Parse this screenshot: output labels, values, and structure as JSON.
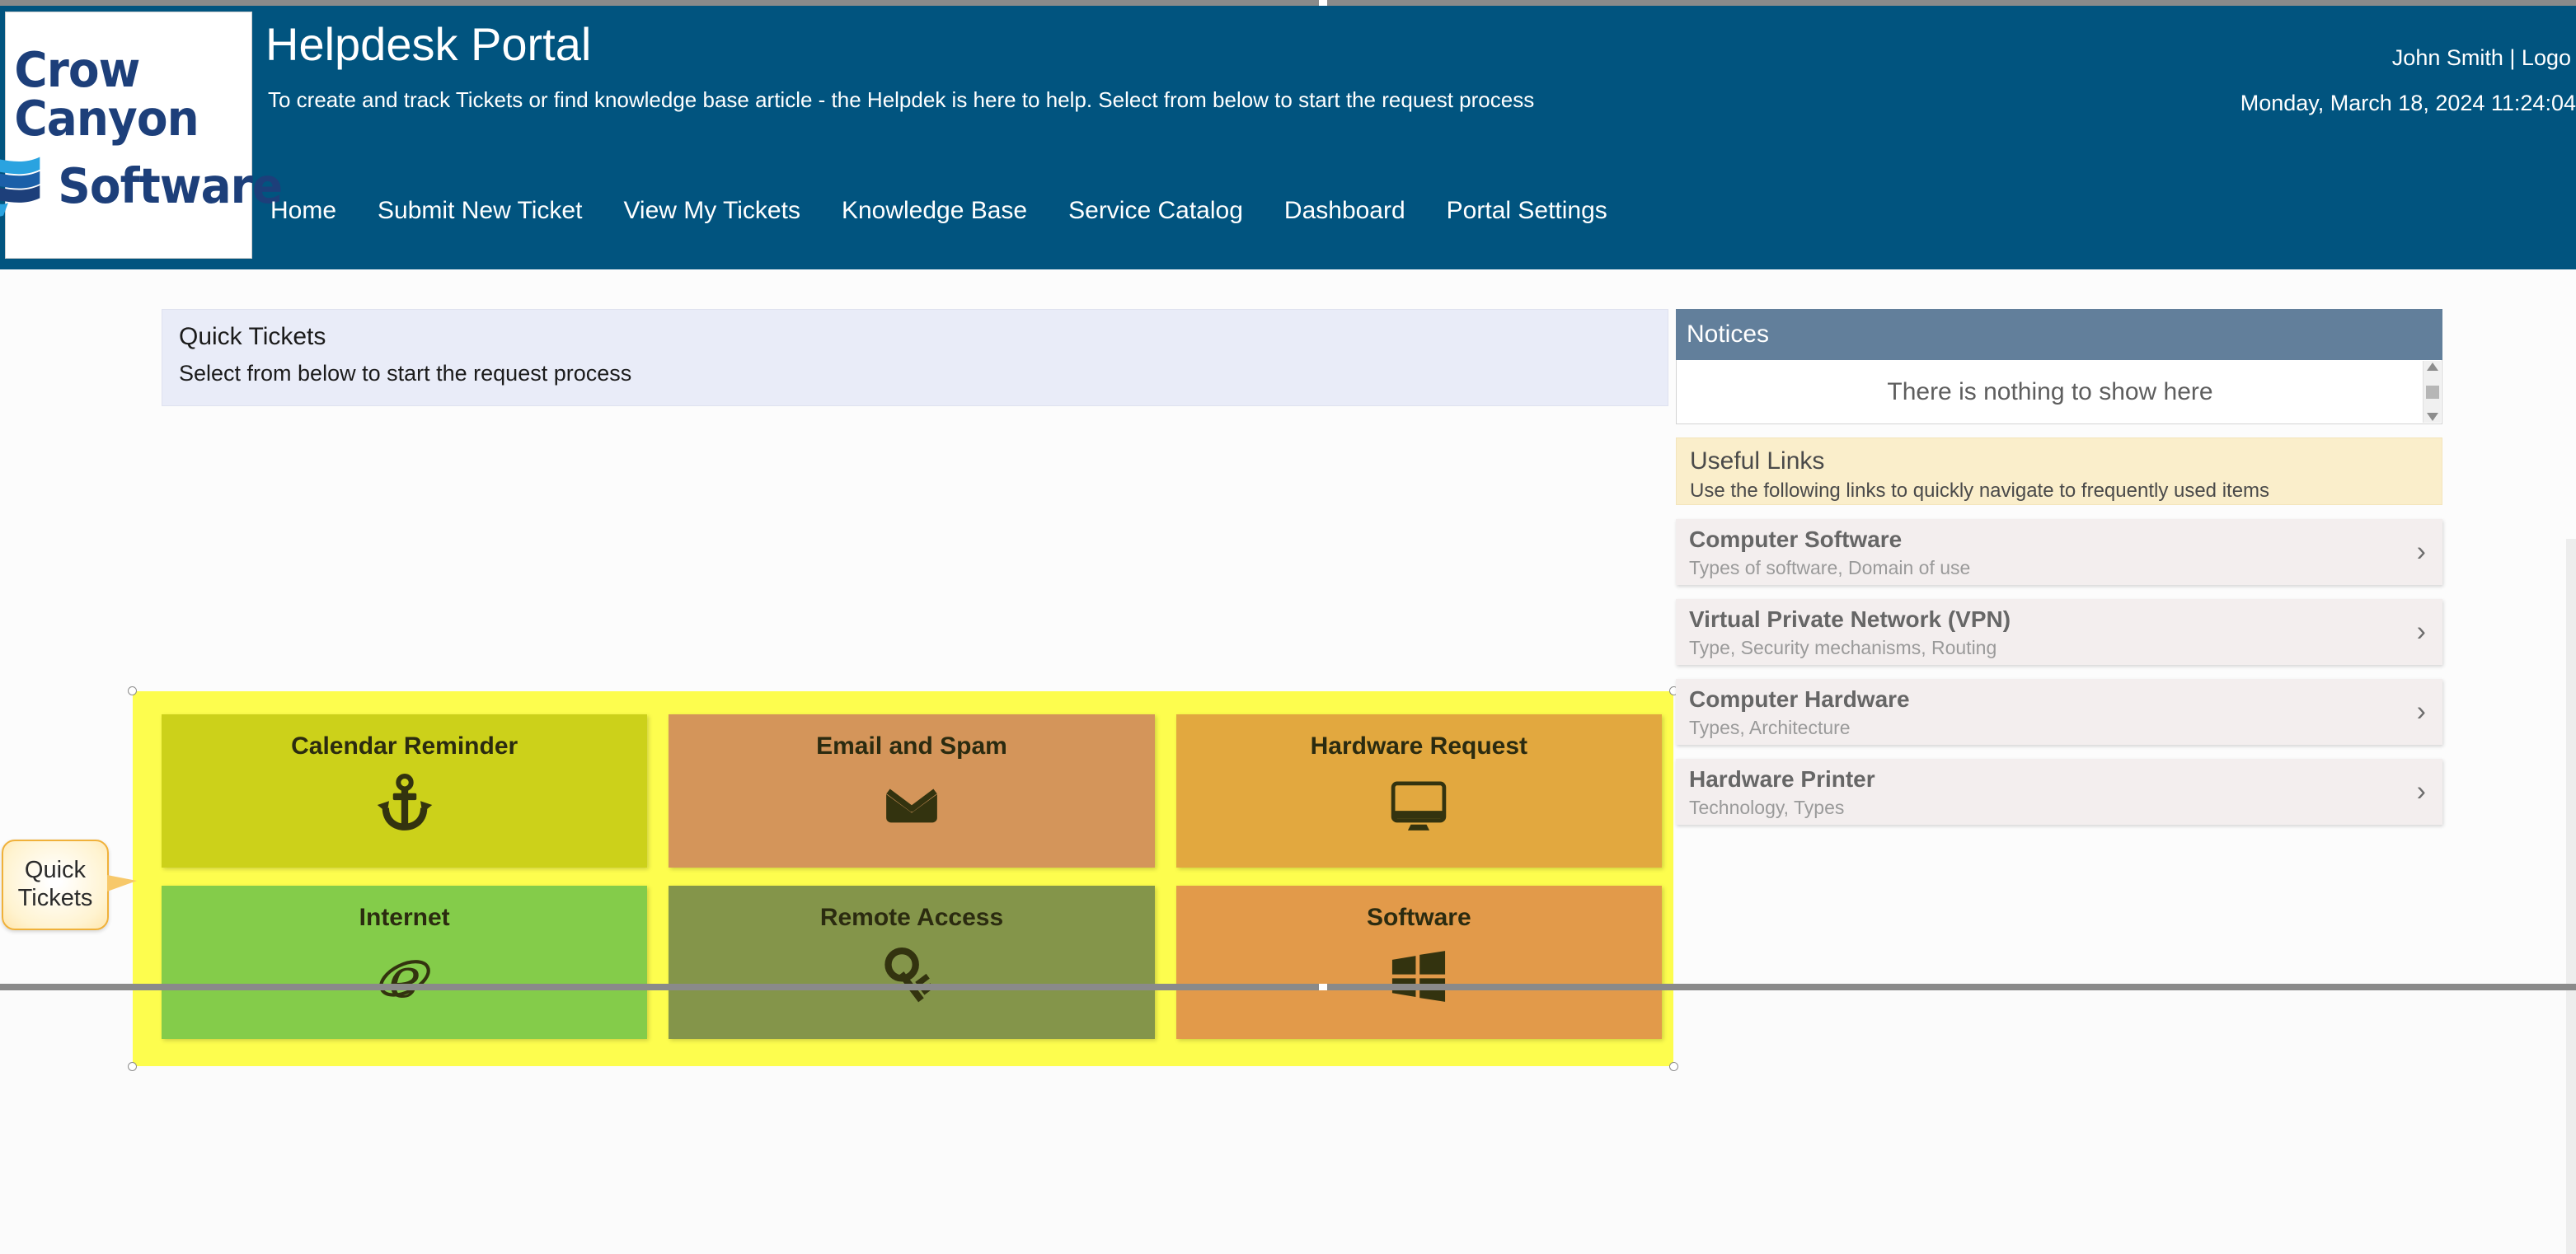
{
  "header": {
    "logo": {
      "line1": "Crow Canyon",
      "line2": "Software",
      "flag_icon": "wave-flag-icon"
    },
    "title": "Helpdesk Portal",
    "subtitle": "To create and track Tickets or find knowledge base article - the Helpdek is here to help. Select from below to start the request process",
    "user_name": "John Smith",
    "separator": "|",
    "logout_label": "Logo",
    "datetime": "Monday, March 18, 2024 11:24:04 ",
    "brand_color": "#01547f",
    "nav": [
      {
        "label": "Home",
        "name": "nav-home"
      },
      {
        "label": "Submit New Ticket",
        "name": "nav-submit-new-ticket"
      },
      {
        "label": "View My Tickets",
        "name": "nav-view-my-tickets"
      },
      {
        "label": "Knowledge Base",
        "name": "nav-knowledge-base"
      },
      {
        "label": "Service Catalog",
        "name": "nav-service-catalog"
      },
      {
        "label": "Dashboard",
        "name": "nav-dashboard"
      },
      {
        "label": "Portal Settings",
        "name": "nav-portal-settings"
      }
    ]
  },
  "quick_tickets": {
    "title": "Quick Tickets",
    "subtitle": "Select from below to start the request process",
    "highlight_color": "#fdfd4e",
    "callout": {
      "line1": "Quick",
      "line2": "Tickets"
    },
    "tiles": [
      {
        "label": "Calendar Reminder",
        "icon": "anchor-icon",
        "color": "#ccd11a"
      },
      {
        "label": "Email and Spam",
        "icon": "envelope-icon",
        "color": "#d4955a"
      },
      {
        "label": "Hardware Request",
        "icon": "monitor-icon",
        "color": "#e2a83f"
      },
      {
        "label": "Internet",
        "icon": "internet-explorer-icon",
        "color": "#84cc4a"
      },
      {
        "label": "Remote Access",
        "icon": "key-icon",
        "color": "#84954a"
      },
      {
        "label": "Software",
        "icon": "windows-icon",
        "color": "#e29a4a"
      }
    ]
  },
  "notices": {
    "title": "Notices",
    "empty_message": "There is nothing to show here",
    "header_color": "#627f9b"
  },
  "useful_links": {
    "title": "Useful Links",
    "subtitle": "Use the following links to quickly navigate to frequently used items",
    "items": [
      {
        "title": "Computer Software",
        "subtitle": "Types of software, Domain of use"
      },
      {
        "title": "Virtual Private Network (VPN)",
        "subtitle": "Type, Security mechanisms, Routing"
      },
      {
        "title": "Computer Hardware",
        "subtitle": "Types, Architecture"
      },
      {
        "title": "Hardware Printer",
        "subtitle": "Technology, Types"
      }
    ],
    "chevron": "›"
  }
}
